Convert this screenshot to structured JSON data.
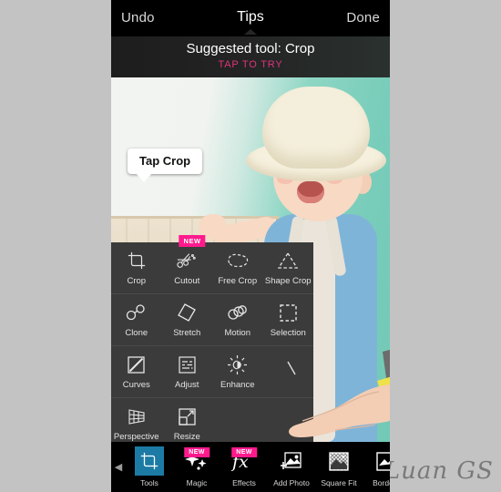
{
  "app": {
    "background_color": "#c3c3c3",
    "accent_pink": "#ff1a8c",
    "accent_teal": "#1b7ba5"
  },
  "topbar": {
    "undo_label": "Undo",
    "title": "Tips",
    "done_label": "Done"
  },
  "suggestion": {
    "text": "Suggested tool: Crop",
    "cta": "TAP TO TRY"
  },
  "tooltip": {
    "text": "Tap Crop"
  },
  "tools_panel": {
    "rows": [
      {
        "cells": [
          {
            "label": "Crop",
            "icon": "crop-icon",
            "badge": ""
          },
          {
            "label": "Cutout",
            "icon": "cutout-icon",
            "badge": "NEW"
          },
          {
            "label": "Free Crop",
            "icon": "free-crop-icon",
            "badge": ""
          },
          {
            "label": "Shape Crop",
            "icon": "shape-crop-icon",
            "badge": ""
          }
        ]
      },
      {
        "cells": [
          {
            "label": "Clone",
            "icon": "clone-icon",
            "badge": ""
          },
          {
            "label": "Stretch",
            "icon": "stretch-icon",
            "badge": ""
          },
          {
            "label": "Motion",
            "icon": "motion-icon",
            "badge": ""
          },
          {
            "label": "Selection",
            "icon": "selection-icon",
            "badge": ""
          }
        ]
      },
      {
        "cells": [
          {
            "label": "Curves",
            "icon": "curves-icon",
            "badge": ""
          },
          {
            "label": "Adjust",
            "icon": "adjust-icon",
            "badge": ""
          },
          {
            "label": "Enhance",
            "icon": "enhance-icon",
            "badge": ""
          },
          {
            "label": "",
            "icon": "shape-crop-icon",
            "badge": ""
          }
        ]
      },
      {
        "cells": [
          {
            "label": "Perspective",
            "icon": "perspective-icon",
            "badge": ""
          },
          {
            "label": "Resize",
            "icon": "resize-icon",
            "badge": ""
          },
          {
            "label": "",
            "icon": "hidden-icon",
            "badge": ""
          },
          {
            "label": "",
            "icon": "hidden-icon",
            "badge": ""
          }
        ]
      }
    ]
  },
  "bottombar": {
    "scroll_left_icon": "chevron-left-icon",
    "items": [
      {
        "label": "Tools",
        "icon": "crop-icon",
        "badge": "",
        "active": true
      },
      {
        "label": "Magic",
        "icon": "sparkle-icon",
        "badge": "NEW",
        "active": false
      },
      {
        "label": "Effects",
        "icon": "fx-icon",
        "badge": "NEW",
        "active": false
      },
      {
        "label": "Add Photo",
        "icon": "add-photo-icon",
        "badge": "",
        "active": false
      },
      {
        "label": "Square Fit",
        "icon": "square-fit-icon",
        "badge": "",
        "active": false
      },
      {
        "label": "Borders",
        "icon": "borders-icon",
        "badge": "",
        "active": false
      }
    ]
  },
  "watermark": {
    "text": "Luan GS"
  }
}
